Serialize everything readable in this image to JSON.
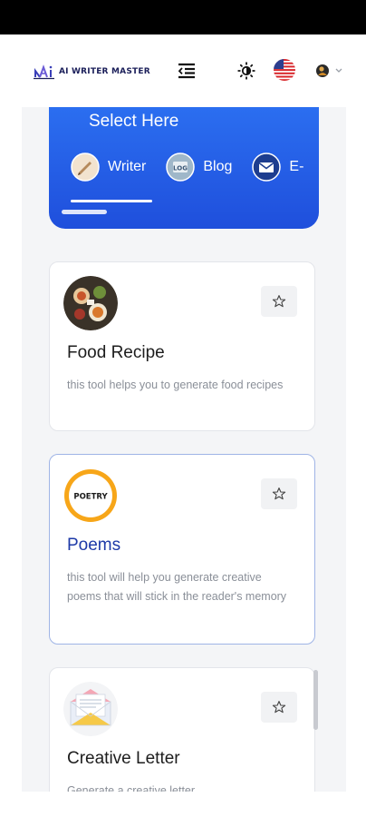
{
  "header": {
    "logo_text": "AI WRITER MASTER",
    "menu_icon": "menu-collapse-icon",
    "theme_icon": "sun-icon",
    "language_icon": "us-flag-icon",
    "user_icon": "avatar-icon",
    "chevron_icon": "chevron-down-icon"
  },
  "categories": {
    "title": "Select Here",
    "items": [
      {
        "label": "Writer",
        "icon": "writer-icon"
      },
      {
        "label": "Blog",
        "icon": "blog-icon"
      },
      {
        "label": "E-",
        "icon": "email-icon"
      }
    ],
    "active_index": 0
  },
  "tools": [
    {
      "title": "Food Recipe",
      "description": "this tool helps you to generate food recipes",
      "thumb": "food-recipe-thumbnail",
      "fav_icon": "star-outline-icon"
    },
    {
      "title": "Poems",
      "description": "this tool will help you generate creative poems that will stick in the reader's memory",
      "thumb": "poetry-thumbnail",
      "thumb_text": "POETRY",
      "fav_icon": "star-outline-icon"
    },
    {
      "title": "Creative Letter",
      "description": "Generate a creative letter",
      "thumb": "letter-thumbnail",
      "fav_icon": "star-outline-icon"
    }
  ],
  "colors": {
    "accent": "#2b6ef0",
    "accent_dark": "#1f4fdc",
    "title_blue": "#1e3aa8",
    "panel_bg": "#f4f5f7"
  }
}
